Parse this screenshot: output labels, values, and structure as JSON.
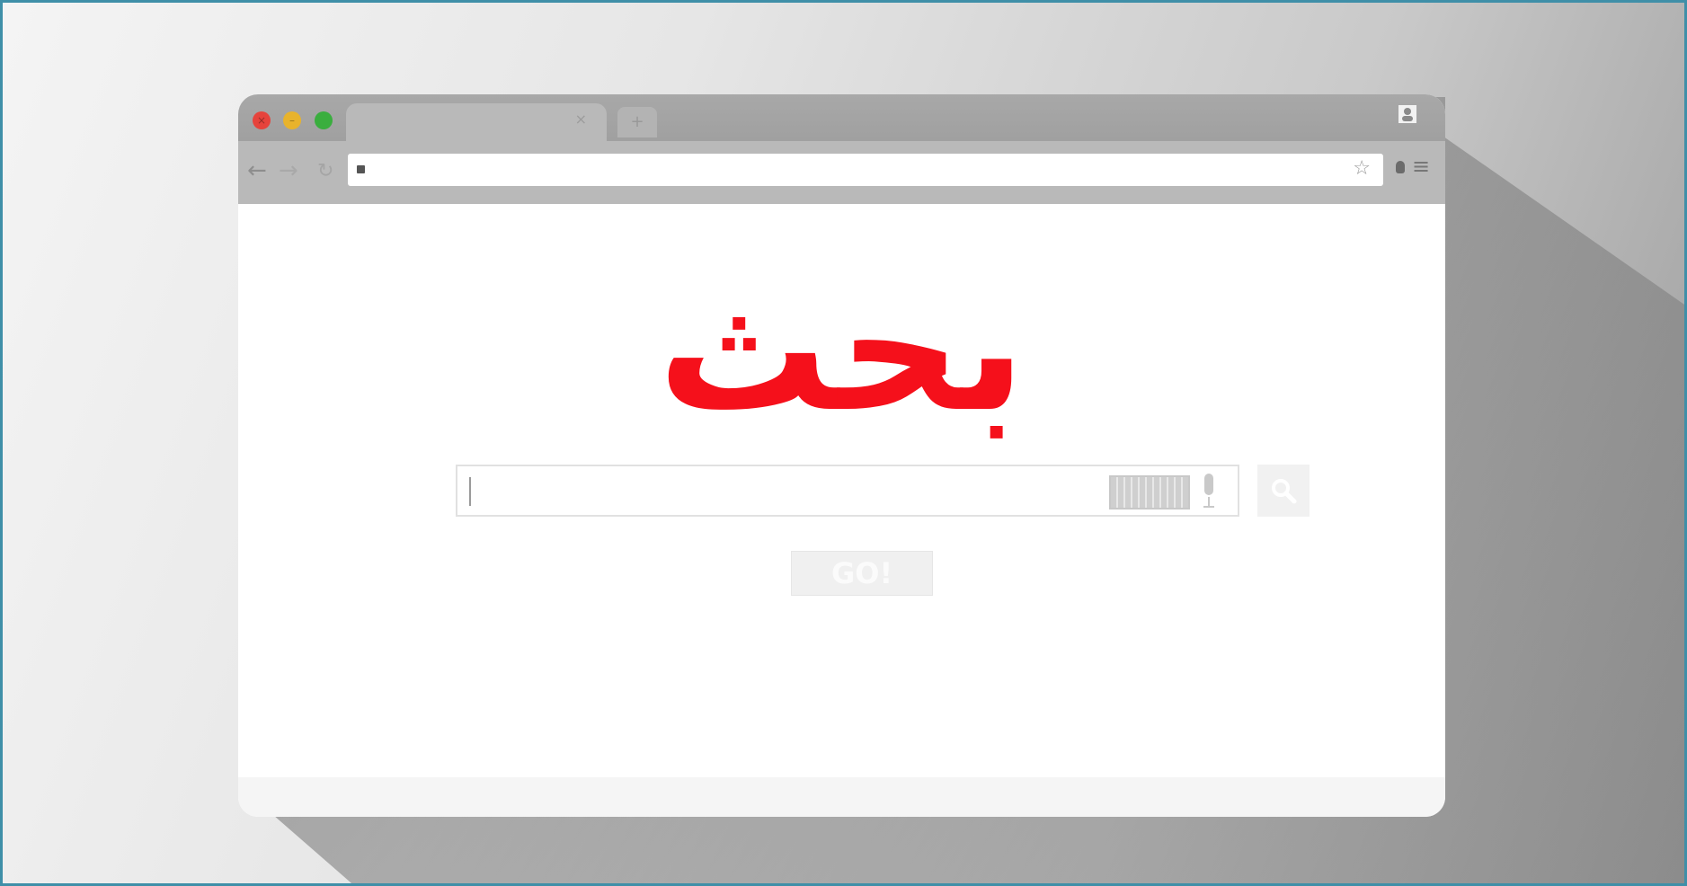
{
  "page": {
    "logo_text": "بحث",
    "go_button_label": "GO!",
    "accent_color": "#f5101b",
    "frame_border_color": "#3f8fa8"
  },
  "browser": {
    "tab_close_glyph": "×",
    "new_tab_glyph": "+",
    "icons": {
      "back": "arrow-left-icon",
      "forward": "arrow-right-icon",
      "reload": "reload-icon",
      "bookmark": "star-icon",
      "menu": "hamburger-menu-icon",
      "profile": "person-icon",
      "search": "magnifier-icon",
      "keyboard": "keyboard-icon",
      "mic": "microphone-icon"
    }
  },
  "search": {
    "input_value": "",
    "input_placeholder": ""
  }
}
